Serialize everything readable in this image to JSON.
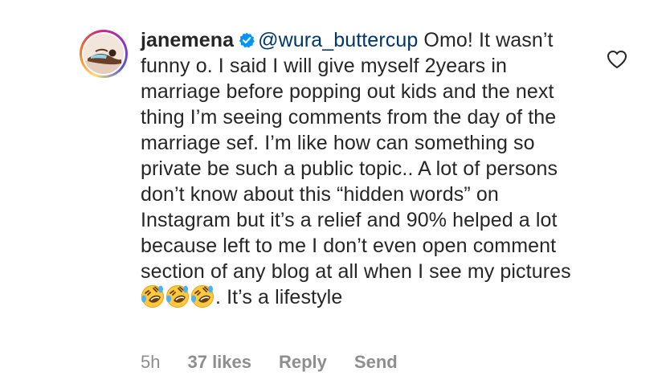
{
  "comment": {
    "username": "janemena",
    "verified": true,
    "mention": "@wura_buttercup",
    "text": " Omo! It wasn’t funny o. I said I will give myself 2years in marriage before popping out kids and the next thing I’m seeing comments from the day of the marriage sef. I’m like how can something so private be such a public topic.. A lot of persons don’t know about this “hidden words” on Instagram but it’s a relief and 90% helped a lot because left to me I don’t even open comment section of any blog at all when I see my pictures",
    "emojis": [
      "rolling-on-floor-laughing",
      "rolling-on-floor-laughing",
      "rolling-on-floor-laughing"
    ],
    "suffix": ". It’s a lifestyle"
  },
  "meta": {
    "time": "5h",
    "likes": "37 likes",
    "reply": "Reply",
    "send": "Send"
  },
  "icons": {
    "like": "heart-outline-icon",
    "verified": "verified-badge-icon"
  },
  "colors": {
    "text": "#262626",
    "mention": "#00376b",
    "muted": "#8e8e8e",
    "verified": "#0095f6"
  }
}
